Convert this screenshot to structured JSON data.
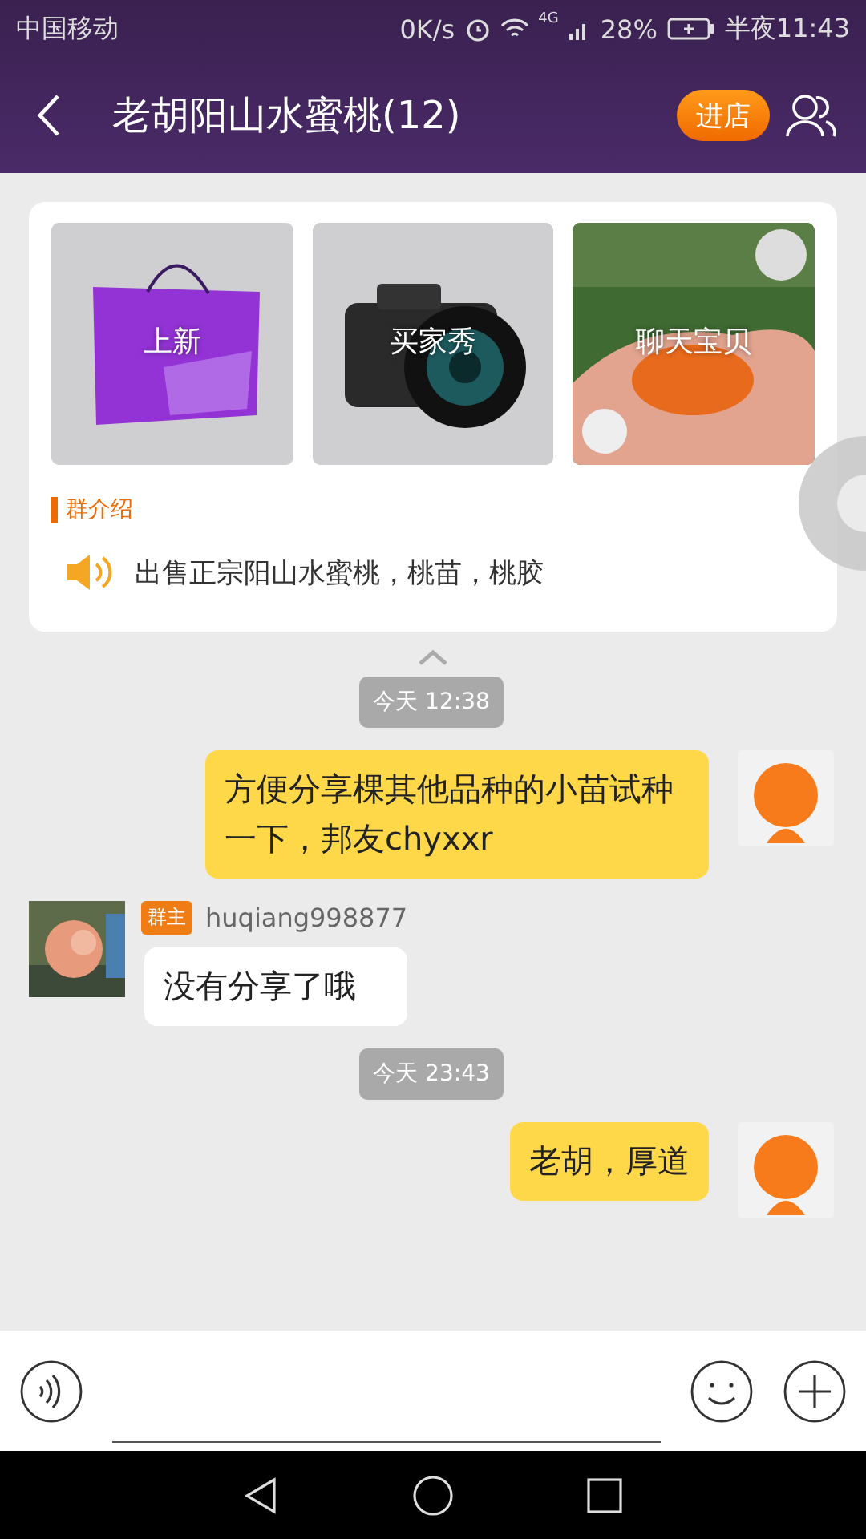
{
  "status_bar": {
    "carrier": "中国移动",
    "speed": "0K/s",
    "network": "4G",
    "battery": "28%",
    "time": "半夜11:43"
  },
  "header": {
    "title": "老胡阳山水蜜桃(12)",
    "shop_button": "进店"
  },
  "tiles": [
    {
      "label": "上新"
    },
    {
      "label": "买家秀"
    },
    {
      "label": "聊天宝贝"
    }
  ],
  "intro": {
    "heading": "群介绍",
    "text": "出售正宗阳山水蜜桃，桃苗，桃胶"
  },
  "messages": [
    {
      "kind": "time",
      "text": "今天 12:38"
    },
    {
      "kind": "mine",
      "text": "方便分享棵其他品种的小苗试种一下，邦友chyxxr"
    },
    {
      "kind": "other",
      "badge": "群主",
      "sender": "huqiang998877",
      "text": "没有分享了哦"
    },
    {
      "kind": "time",
      "text": "今天 23:43"
    },
    {
      "kind": "mine",
      "text": "老胡，厚道"
    }
  ]
}
